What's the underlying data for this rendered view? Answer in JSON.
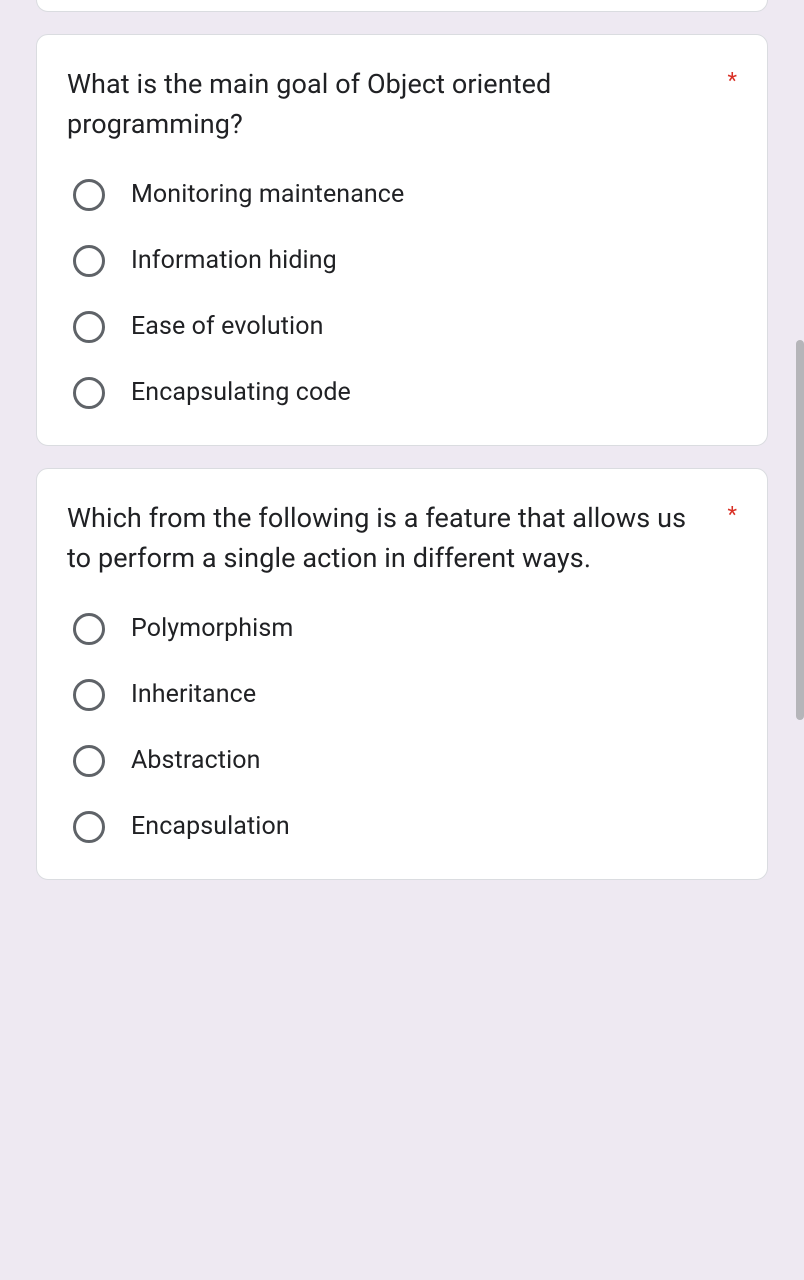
{
  "required_marker": "*",
  "questions": [
    {
      "text": "What is the main goal of Object oriented programming?",
      "required": true,
      "options": [
        "Monitoring maintenance",
        "Information hiding",
        "Ease of evolution",
        "Encapsulating code"
      ]
    },
    {
      "text": "Which from the following is a feature that allows us to perform a single action in different ways.",
      "required": true,
      "options": [
        "Polymorphism",
        "Inheritance",
        "Abstraction",
        "Encapsulation"
      ]
    }
  ]
}
